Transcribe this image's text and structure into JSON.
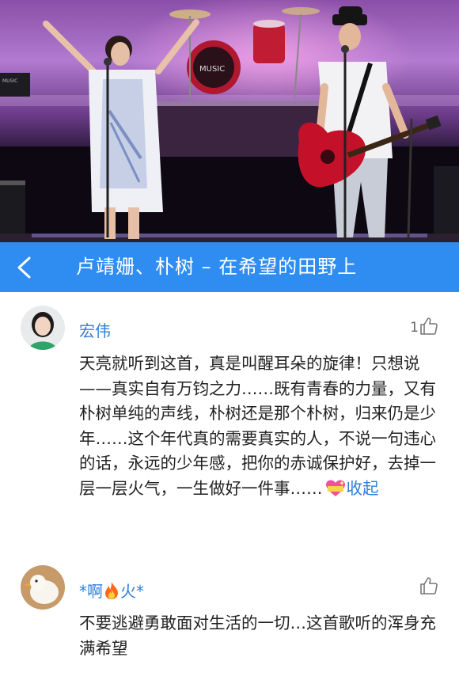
{
  "song": {
    "title": "卢靖姗、朴树 – 在希望的田野上"
  },
  "colors": {
    "accent": "#2f8cf1",
    "username": "#2f7ed8",
    "text": "#222222"
  },
  "photo": {
    "icon": "concert-stage-photo",
    "drum_text": "MUSIC",
    "amp_text": "MUSIC"
  },
  "comments": [
    {
      "user": "宏伟",
      "likes": "1",
      "text": "天亮就听到这首，真是叫醒耳朵的旋律！只想说——真实自有万钧之力……既有青春的力量，又有朴树单纯的声线，朴树还是那个朴树，归来仍是少年……这个年代真的需要真实的人，不说一句违心的话，永远的少年感，把你的赤诚保护好，去掉一层一层火气，一生做好一件事……",
      "emoji": "sparkling-heart-icon",
      "collapse": "收起"
    },
    {
      "user_prefix": "*啊",
      "user_emoji": "fire-icon",
      "user_suffix": "火*",
      "likes": "",
      "text": "不要逃避勇敢面对生活的一切…这首歌听的浑身充满希望"
    }
  ]
}
